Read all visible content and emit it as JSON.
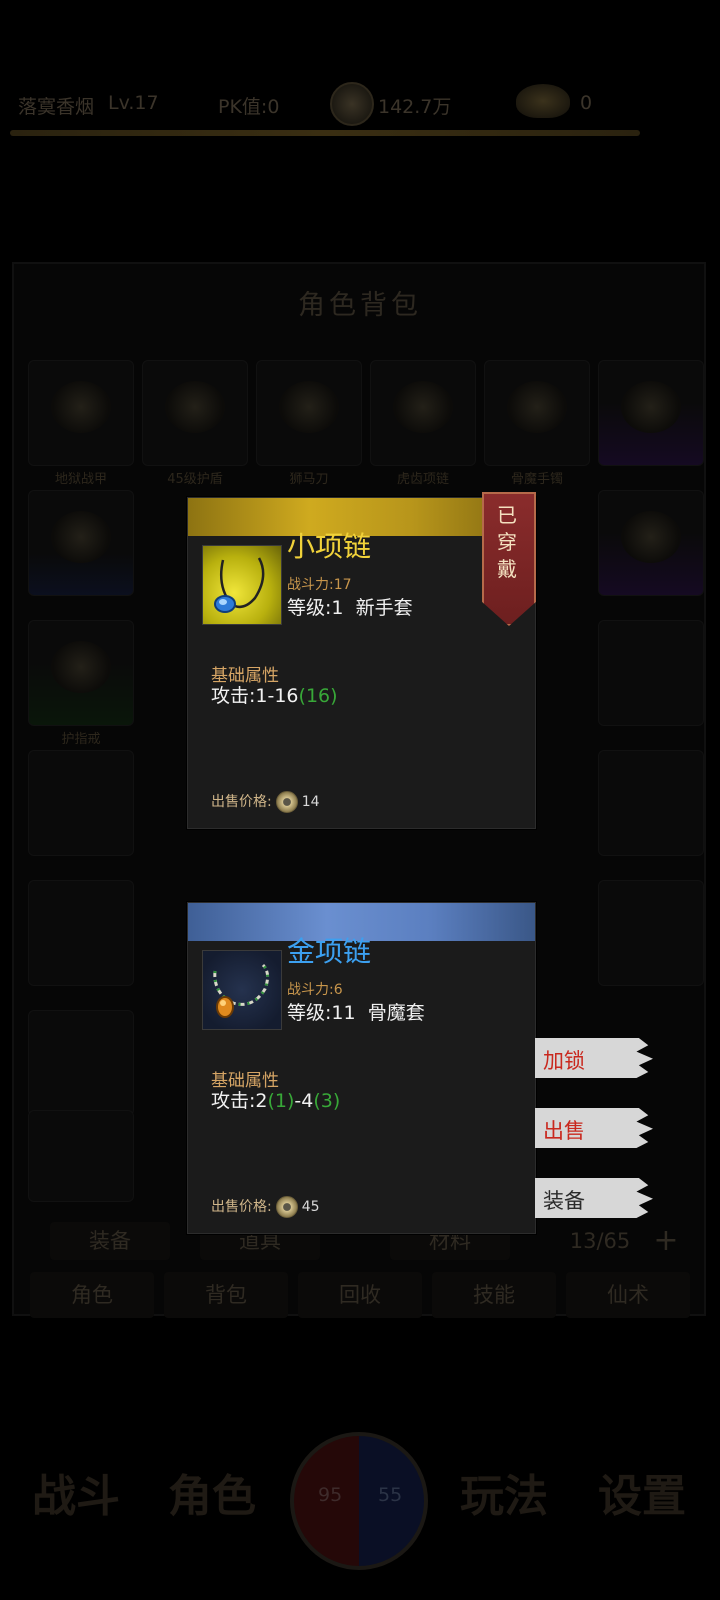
{
  "topbar": {
    "player": "落寞香烟",
    "level": "Lv.17",
    "pk": "PK值:0",
    "coins": "142.7万",
    "ingots": "0"
  },
  "bag": {
    "title": "角色背包",
    "slot_names": [
      "地狱战甲",
      "45级护盾",
      "狮马刀",
      "虎齿项链",
      "骨魔手镯",
      "",
      "",
      "",
      "",
      "",
      "",
      "",
      "护指戒"
    ],
    "bottom_tabs": [
      "装备",
      "道具",
      "材料"
    ],
    "capacity": "13/65",
    "menu": [
      "角色",
      "背包",
      "回收",
      "技能",
      "仙术"
    ]
  },
  "nav": {
    "items": [
      "战斗",
      "角色",
      "玩法",
      "设置"
    ],
    "hp_value": "95",
    "mp_value": "55"
  },
  "card_equipped": {
    "name": "小项链",
    "name_color": "#f0d23a",
    "power": "战斗力:17",
    "level": "等级:1",
    "set": "新手套",
    "worn_badge": "已穿戴",
    "section": "基础属性",
    "attr_prefix": "攻击:1-16",
    "attr_bonus": "(16)",
    "price_label": "出售价格:",
    "price": "14",
    "icon": "necklace-icon"
  },
  "card_new": {
    "name": "金项链",
    "name_color": "#3ca0f0",
    "power": "战斗力:6",
    "level": "等级:11",
    "set": "骨魔套",
    "section": "基础属性",
    "attr_a": "攻击:2",
    "attr_b": "(1)",
    "attr_c": "-4",
    "attr_d": "(3)",
    "price_label": "出售价格:",
    "price": "45",
    "icon": "gold-necklace-icon"
  },
  "actions": {
    "lock": "加锁",
    "sell": "出售",
    "equip": "装备"
  }
}
